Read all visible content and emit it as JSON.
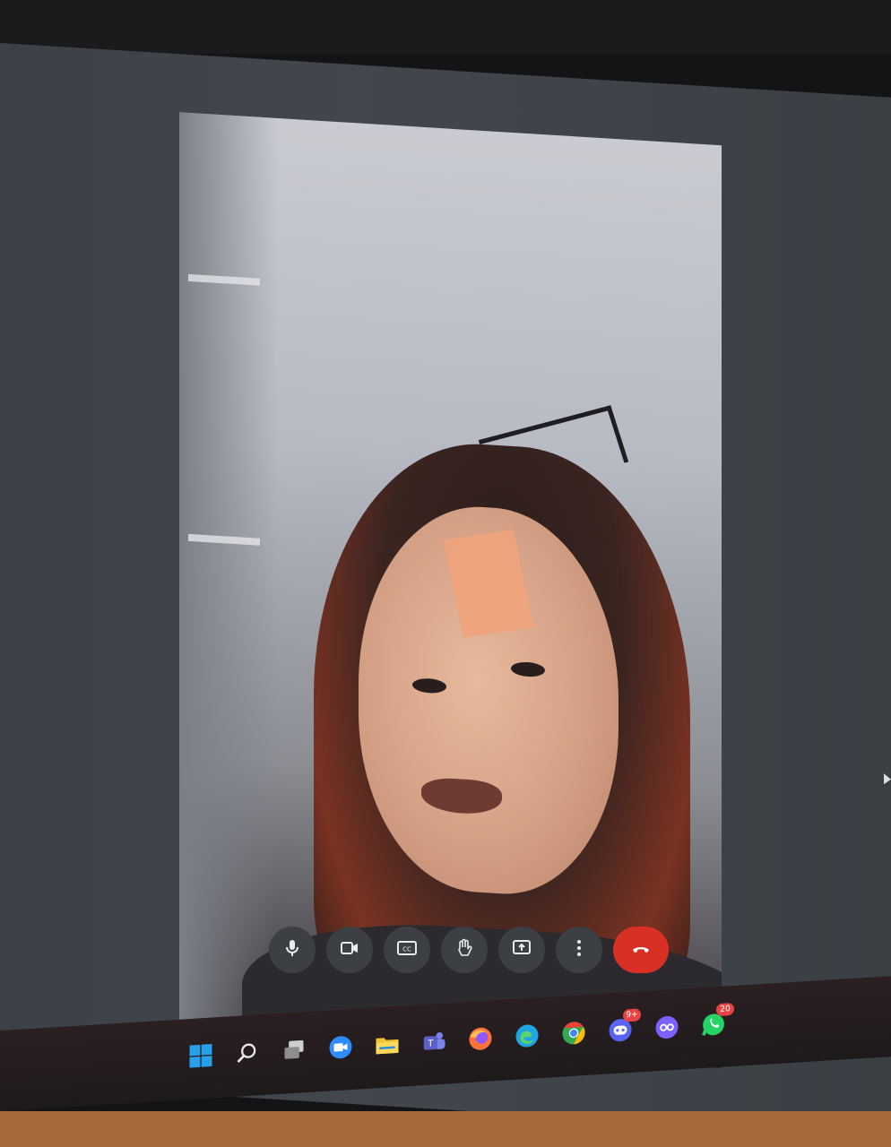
{
  "call": {
    "controls": [
      {
        "name": "microphone-button",
        "icon": "microphone-icon"
      },
      {
        "name": "camera-button",
        "icon": "video-camera-icon"
      },
      {
        "name": "captions-button",
        "icon": "closed-captions-icon",
        "label": "CC"
      },
      {
        "name": "raise-hand-button",
        "icon": "hand-icon"
      },
      {
        "name": "present-screen-button",
        "icon": "present-screen-icon"
      },
      {
        "name": "more-options-button",
        "icon": "more-vertical-icon"
      },
      {
        "name": "end-call-button",
        "icon": "hang-up-icon"
      }
    ],
    "end_call_color": "#d93025"
  },
  "taskbar": {
    "apps": [
      {
        "name": "start-button",
        "icon": "windows-logo-icon",
        "color": "#27a0ea"
      },
      {
        "name": "search-button",
        "icon": "search-icon",
        "color": "#e8e8e8"
      },
      {
        "name": "task-view-button",
        "icon": "task-view-icon",
        "color": "#cfcfcf"
      },
      {
        "name": "zoom-meet-app",
        "icon": "video-chat-icon",
        "color": "#2d8cff"
      },
      {
        "name": "file-explorer-app",
        "icon": "folder-icon",
        "color": "#f4c430"
      },
      {
        "name": "teams-app",
        "icon": "teams-icon",
        "color": "#5b5fc7"
      },
      {
        "name": "firefox-app",
        "icon": "firefox-icon",
        "color": "#ff7139"
      },
      {
        "name": "edge-app",
        "icon": "edge-icon",
        "color": "#1fa5e0"
      },
      {
        "name": "chrome-app",
        "icon": "chrome-icon",
        "color": "#34a853"
      },
      {
        "name": "discord-app",
        "icon": "discord-icon",
        "color": "#5865f2",
        "badge": "9+"
      },
      {
        "name": "messenger-app",
        "icon": "messenger-icon",
        "color": "#7b61ff"
      },
      {
        "name": "whatsapp-app",
        "icon": "whatsapp-icon",
        "color": "#25d366",
        "badge": "20"
      }
    ]
  }
}
